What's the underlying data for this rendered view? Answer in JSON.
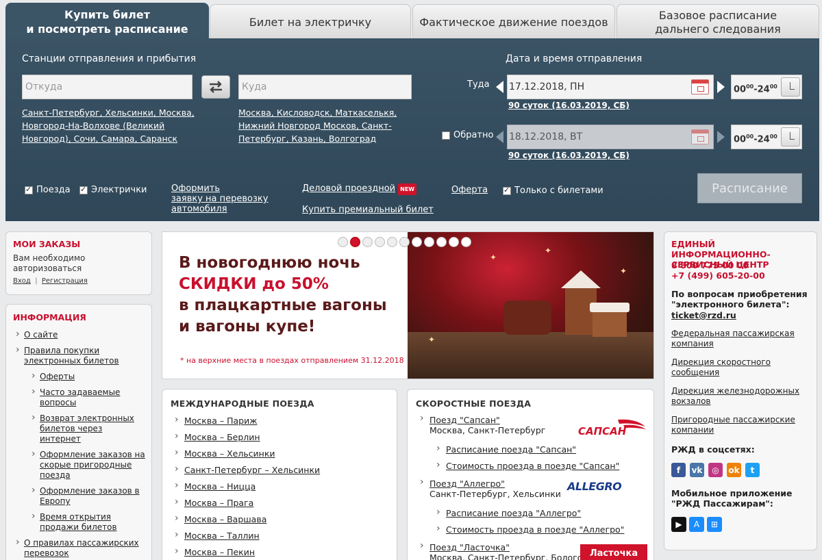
{
  "tabs": [
    {
      "line1": "Купить билет",
      "line2": "и посмотреть расписание"
    },
    {
      "line1": "Билет на электричку",
      "line2": ""
    },
    {
      "line1": "Фактическое движение поездов",
      "line2": ""
    },
    {
      "line1": "Базовое расписание",
      "line2": "дальнего следования"
    }
  ],
  "search": {
    "stations_label": "Станции отправления и прибытия",
    "from_placeholder": "Откуда",
    "to_placeholder": "Куда",
    "from_quick": "Санкт-Петербург, Хельсинки, Москва, Новгород-На-Волхове (Великий Новгород), Сочи, Самара, Саранск",
    "from_quick_lines": [
      "Санкт-Петербург, Хельсинки, Москва,",
      "Новгород-На-Волхове (Великий",
      "Новгород), Сочи, Самара, Саранск"
    ],
    "to_quick_lines": [
      "Москва, Кисловодск, Маткаселькя,",
      "Нижний Новгород Москов, Санкт-",
      "Петербург, Казань, Волгоград"
    ],
    "date_label": "Дата и время отправления",
    "there_label": "Туда",
    "there_date": "17.12.2018, ПН",
    "there_limit": "90 суток (16.03.2019, СБ)",
    "back_label": "Обратно",
    "back_date": "18.12.2018, ВТ",
    "back_limit": "90 суток (16.03.2019, СБ)",
    "time_from": "00",
    "time_sup1": "00",
    "time_to": "-24",
    "time_sup2": "00",
    "opt_trains": "Поезда",
    "opt_suburban": "Электрички",
    "link_car_lines": [
      "Оформить ",
      "заявку на перевозку ",
      "автомобиля"
    ],
    "link_business": "Деловой проездной",
    "new_badge": "NEW",
    "link_premium": "Купить премиальный билет",
    "link_offer": "Оферта",
    "opt_only_tickets": "Только с билетами",
    "schedule_button": "Расписание"
  },
  "orders": {
    "title": "МОИ ЗАКАЗЫ",
    "text_lines": [
      "Вам необходимо",
      "авторизоваться"
    ],
    "login": "Вход",
    "separator": "|",
    "register": "Регистрация"
  },
  "info": {
    "title": "ИНФОРМАЦИЯ",
    "items": [
      {
        "text": "О сайте",
        "sub": false,
        "lines": [
          "О сайте"
        ]
      },
      {
        "text": "Правила покупки электронных билетов",
        "sub": false,
        "lines": [
          "Правила покупки",
          "электронных билетов"
        ]
      },
      {
        "text": "Оферты",
        "sub": true,
        "lines": [
          "Оферты"
        ]
      },
      {
        "text": "Часто задаваемые вопросы",
        "sub": true,
        "lines": [
          "Часто задаваемые",
          "вопросы"
        ]
      },
      {
        "text": "Возврат электронных билетов через интернет",
        "sub": true,
        "lines": [
          "Возврат электронных",
          "билетов через",
          "интернет"
        ]
      },
      {
        "text": "Оформление заказов на скорые пригородные поезда",
        "sub": true,
        "lines": [
          "Оформление заказов на",
          "скорые пригородные",
          "поезда"
        ]
      },
      {
        "text": "Оформление заказов в Европу",
        "sub": true,
        "lines": [
          "Оформление заказов в",
          "Европу"
        ]
      },
      {
        "text": "Время открытия продажи билетов",
        "sub": true,
        "lines": [
          "Время открытия",
          "продажи билетов"
        ]
      },
      {
        "text": "О правилах пассажирских перевозок",
        "sub": false,
        "lines": [
          "О правилах пассажирских",
          "перевозок"
        ]
      }
    ]
  },
  "banner": {
    "line1": "В новогоднюю ночь",
    "line2": "СКИДКИ до 50%",
    "line3": "в плацкартные вагоны",
    "line4": "и вагоны купе!",
    "note": "* на верхние места в поездах отправлением 31.12.2018",
    "slides_total": 11,
    "slide_active": 2
  },
  "international": {
    "title": "МЕЖДУНАРОДНЫЕ ПОЕЗДА",
    "routes": [
      "Москва – Париж",
      "Москва – Берлин",
      "Москва – Хельсинки",
      "Санкт-Петербург – Хельсинки",
      "Москва – Ницца",
      "Москва – Прага",
      "Москва – Варшава",
      "Москва – Таллин",
      "Москва – Пекин"
    ]
  },
  "fast": {
    "title": "СКОРОСТНЫЕ ПОЕЗДА",
    "sapsan": {
      "name": "Поезд \"Сапсан\"",
      "route": "Москва, Санкт-Петербург",
      "schedule": "Расписание поезда \"Сапсан\"",
      "price": "Стоимость проезда в поезде \"Сапсан\"",
      "logo": "САПСАН"
    },
    "allegro": {
      "name": "Поезд \"Аллегро\"",
      "route": "Санкт-Петербург, Хельсинки",
      "schedule": "Расписание поезда \"Аллегро\"",
      "price": "Стоимость проезда в поезде \"Аллегро\"",
      "logo": "ALLEGRO"
    },
    "lastochka": {
      "name": "Поезд \"Ласточка\"",
      "route": "Москва, Санкт-Петербург, Бологое,",
      "logo": "Ласточка"
    }
  },
  "contact": {
    "title_lines": [
      "ЕДИНЫЙ ИНФОРМАЦИОННО-",
      "СЕРВИСНЫЙ ЦЕНТР"
    ],
    "phone1": "8 800 775 00 00",
    "phone2": "+7 (499) 605-20-00",
    "question_lines": [
      "По вопросам приобретения",
      "\"электронного билета\":"
    ],
    "email": "ticket@rzd.ru",
    "links": [
      [
        "Федеральная пассажирская",
        "компания"
      ],
      [
        "Дирекция скоростного",
        "сообщения"
      ],
      [
        "Дирекция железнодорожных",
        "вокзалов"
      ],
      [
        "Пригородные пассажирские",
        "компании"
      ]
    ],
    "social_title": "РЖД в соцсетях:",
    "social": [
      {
        "icon": "facebook-icon",
        "glyph": "f",
        "color": "#3b5998"
      },
      {
        "icon": "vk-icon",
        "glyph": "vk",
        "color": "#4a76a8"
      },
      {
        "icon": "instagram-icon",
        "glyph": "◎",
        "color": "#c13584"
      },
      {
        "icon": "odnoklassniki-icon",
        "glyph": "ok",
        "color": "#ee8208"
      },
      {
        "icon": "twitter-icon",
        "glyph": "t",
        "color": "#1da1f2"
      }
    ],
    "app_title_lines": [
      "Мобильное приложение",
      "\"РЖД Пассажирам\":"
    ],
    "apps": [
      {
        "icon": "google-play-icon",
        "glyph": "▶",
        "color": "#111"
      },
      {
        "icon": "app-store-icon",
        "glyph": "A",
        "color": "#1a8cff"
      },
      {
        "icon": "windows-store-icon",
        "glyph": "⊞",
        "color": "#1a8cff"
      }
    ]
  },
  "colors": {
    "accent_red": "#c8102e",
    "panel": "#3b5466"
  }
}
